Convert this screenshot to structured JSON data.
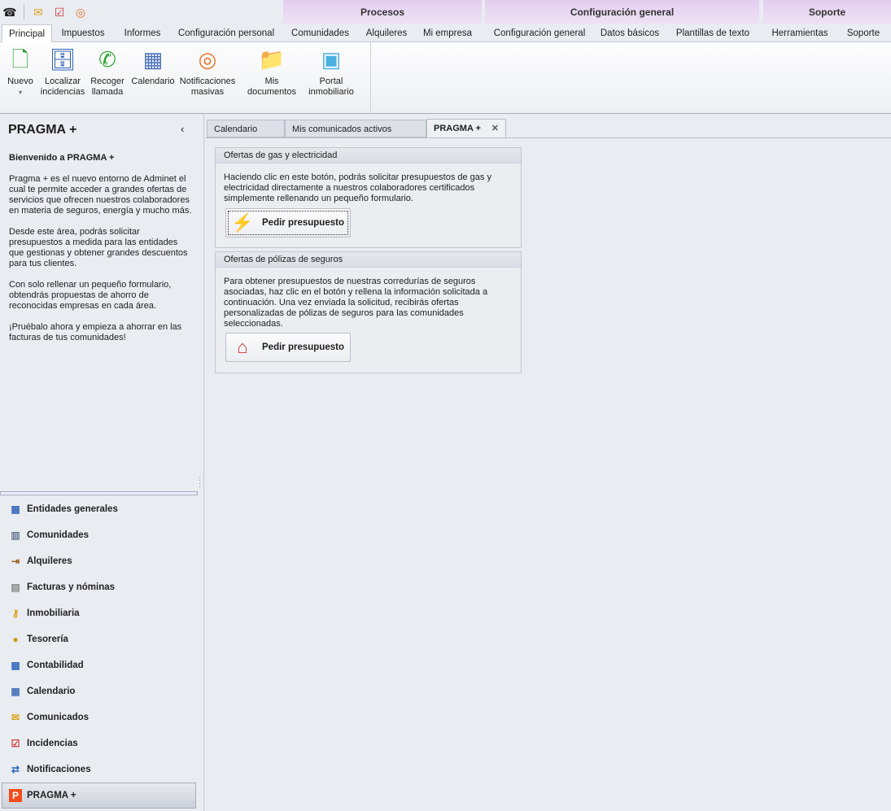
{
  "quick_access": [
    {
      "icon": "phone-icon"
    },
    {
      "icon": "mail-icon"
    },
    {
      "icon": "clipboard-icon"
    },
    {
      "icon": "broadcast-icon"
    }
  ],
  "context_groups": [
    {
      "label": "Procesos"
    },
    {
      "label": "Configuración general"
    },
    {
      "label": "Soporte"
    }
  ],
  "ribbon_tabs": [
    "Principal",
    "Impuestos",
    "Informes",
    "Configuración personal",
    "Comunidades",
    "Alquileres",
    "Mi empresa",
    "Configuración general",
    "Datos básicos",
    "Plantillas de texto",
    "Herramientas",
    "Soporte"
  ],
  "ribbon_buttons": [
    {
      "label": "Nuevo",
      "label2": "▾",
      "icon": "new-document-icon"
    },
    {
      "label": "Localizar",
      "label2": "incidencias",
      "icon": "file-cabinet-icon"
    },
    {
      "label": "Recoger",
      "label2": "llamada",
      "icon": "phone-icon"
    },
    {
      "label": "Calendario",
      "label2": "",
      "icon": "calendar-icon"
    },
    {
      "label": "Notificaciones",
      "label2": "masivas",
      "icon": "broadcast-icon"
    },
    {
      "label": "Mis documentos",
      "label2": "",
      "icon": "folder-icon"
    },
    {
      "label": "Portal",
      "label2": "inmobiliario",
      "icon": "portal-icon"
    }
  ],
  "left_panel": {
    "title": "PRAGMA +",
    "welcome": "Bienvenido a PRAGMA +",
    "paragraphs": [
      "Pragma + es el nuevo entorno de Adminet el cual te permite acceder a grandes ofertas de servicios que ofrecen nuestros colaboradores en materia de seguros, energía y mucho más.",
      "Desde este área, podrás solicitar presupuestos a medida para las entidades que gestionas y obtener grandes descuentos para tus clientes.",
      "Con solo rellenar un pequeño formulario, obtendrás propuestas de ahorro de reconocidas empresas en cada área.",
      "¡Pruébalo ahora y empieza a ahorrar en las facturas de tus comunidades!"
    ]
  },
  "nav_items": [
    "Entidades generales",
    "Comunidades",
    "Alquileres",
    "Facturas y nóminas",
    "Inmobiliaria",
    "Tesorería",
    "Contabilidad",
    "Calendario",
    "Comunicados",
    "Incidencias",
    "Notificaciones",
    "PRAGMA +"
  ],
  "doc_tabs": [
    "Calendario",
    "Mis comunicados activos",
    "PRAGMA +"
  ],
  "panels": [
    {
      "title": "Ofertas de gas y electricidad",
      "text": "Haciendo clic en este botón, podrás solicitar presupuestos de gas y electricidad directamente a nuestros colaboradores certificados simplemente rellenando un pequeño formulario.",
      "button": "Pedir presupuesto"
    },
    {
      "title": "Ofertas de pólizas de seguros",
      "text": "Para obtener presupuestos de nuestras corredurías de seguros asociadas, haz clic en el botón y rellena la información solicitada a continuación. Una vez enviada la solicitud, recibirás ofertas personalizadas de pólizas de seguros para las comunidades seleccionadas.",
      "button": "Pedir presupuesto"
    }
  ]
}
